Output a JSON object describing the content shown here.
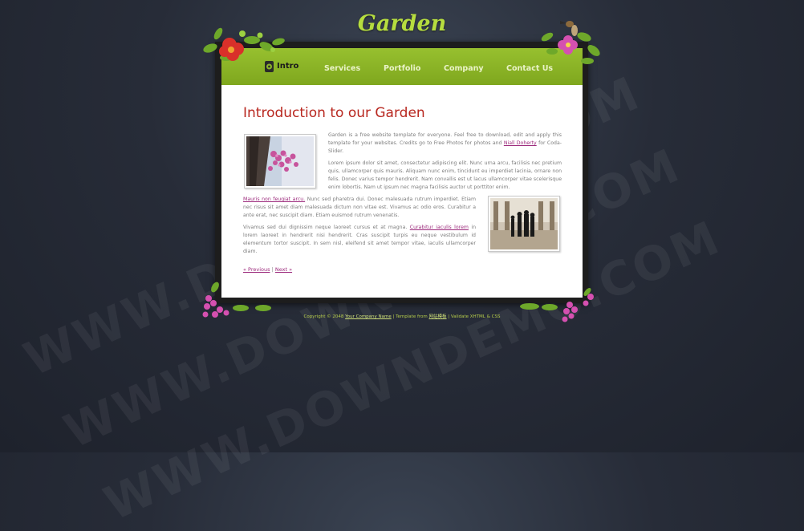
{
  "site": {
    "title": "Garden"
  },
  "nav": {
    "logo_text": "Intro",
    "items": [
      "Services",
      "Portfolio",
      "Company",
      "Contact Us"
    ]
  },
  "main": {
    "heading": "Introduction to our Garden",
    "para1_a": "Garden is a free website template for everyone. Feel free to download, edit and apply this template for your websites. Credits go to Free Photos for photos and ",
    "para1_link": "Niall Doherty",
    "para1_b": " for Coda-Slider.",
    "para2": "Lorem ipsum dolor sit amet, consectetur adipiscing elit. Nunc urna arcu, facilisis nec pretium quis, ullamcorper quis mauris. Aliquam nunc enim, tincidunt eu imperdiet lacinia, ornare non felis. Donec varius tempor hendrerit. Nam convallis est ut lacus ullamcorper vitae scelerisque enim lobortis. Nam ut ipsum nec magna facilisis auctor ut porttitor enim.",
    "para3_link": "Mauris non feugiat arcu.",
    "para3": " Nunc sed pharetra dui. Donec malesuada rutrum imperdiet. Etiam nec risus sit amet diam malesuada dictum non vitae est. Vivamus ac odio eros. Curabitur a ante erat, nec suscipit diam. Etiam euismod rutrum venenatis.",
    "para4_a": "Vivamus sed dui dignissim neque laoreet cursus et at magna. ",
    "para4_link": "Curabitur iaculis lorem",
    "para4_b": " in lorem laoreet in hendrerit nisi hendrerit. Cras suscipit turpis eu neque vestibulum id elementum tortor suscipit. In sem nisl, eleifend sit amet tempor vitae, iaculis ullamcorper diam.",
    "prev": "« Previous",
    "separator": "|",
    "next": "Next »"
  },
  "footer": {
    "copyright": "Copyright © 2048 ",
    "company": "Your Company Name",
    "sep1": " | Template from ",
    "template_source": "网站模板",
    "sep2": " | Validate XHTML & CSS"
  },
  "watermark": "WWW.DOWNDEMO.COM",
  "colors": {
    "title": "#b6dd3f",
    "nav_bg": "#8db52a",
    "heading": "#b8271f",
    "link": "#9c2a7c",
    "background": "#272c38"
  }
}
